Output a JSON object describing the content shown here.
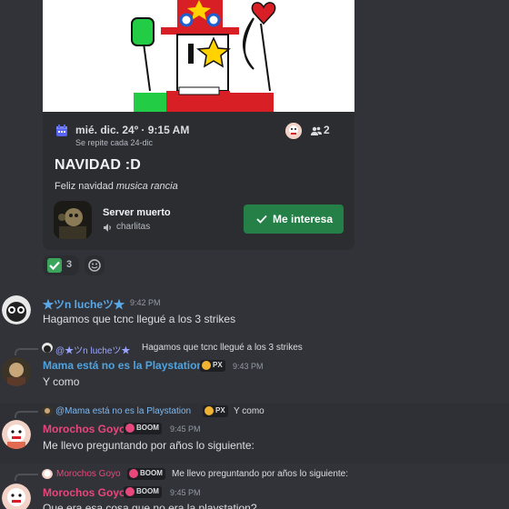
{
  "event": {
    "date": "mié. dic. 24º · 9:15 AM",
    "repeat": "Se repite cada 24-dic",
    "interested_count": "2",
    "title": "NAVIDAD :D",
    "description_plain": "Feliz navidad ",
    "description_italic": "musica rancia",
    "server_name": "Server muerto",
    "channel_name": "charlitas",
    "interest_button": "Me interesa",
    "calendar_icon": "calendar-icon",
    "accent_green": "#248046",
    "accent_blue": "#5865f2"
  },
  "reactions": [
    {
      "emoji": "check-mark-emoji",
      "count": "3"
    }
  ],
  "messages": [
    {
      "author": "★ツn lucheツ★",
      "author_color": "#5aa8e6",
      "time": "9:42 PM",
      "text": "Hagamos que tcnc llegué a los 3 strikes"
    },
    {
      "reply_author": "@★ツn lucheツ★",
      "reply_text": "Hagamos que tcnc llegué a los 3 strikes",
      "author": "Mama está no es la Playstation",
      "author_color": "#4fa3e0",
      "badge": "PX",
      "time": "9:43 PM",
      "text": "Y como"
    },
    {
      "reply_author": "@Mama está no es la Playstation",
      "reply_badge": "PX",
      "reply_text": "Y como",
      "author": "Morochos Goyo",
      "author_color": "#e8477c",
      "badge": "BOOM",
      "time": "9:45 PM",
      "text": "Me llevo preguntando por años lo siguiente:"
    },
    {
      "reply_author": "Morochos Goyo",
      "reply_badge": "BOOM",
      "reply_text": "Me llevo preguntando por años lo siguiente:",
      "author": "Morochos Goyo",
      "author_color": "#e8477c",
      "badge": "BOOM",
      "time": "9:45 PM",
      "text": "Que era esa cosa que no era la playstation?"
    }
  ]
}
